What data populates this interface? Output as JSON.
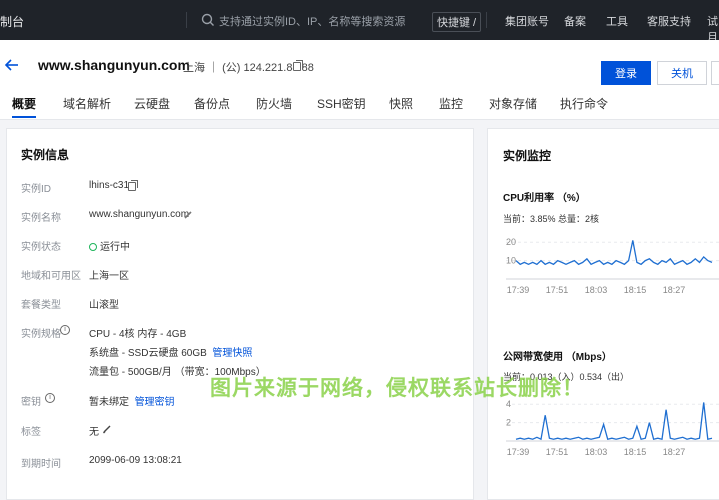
{
  "topbar": {
    "brand": "制台",
    "search_placeholder": "支持通过实例ID、IP、名称等搜索资源",
    "shortcut": "快捷键 /",
    "nav": [
      "集团账号",
      "备案",
      "工具",
      "客服支持",
      "试月"
    ]
  },
  "header": {
    "title": "www.shangunyun.com",
    "region": "上海 ｜ (公) 124.221.88.88",
    "login_button": "登录",
    "shutdown_button": "关机"
  },
  "tabs": [
    "概要",
    "域名解析",
    "云硬盘",
    "备份点",
    "防火墙",
    "SSH密钥",
    "快照",
    "监控",
    "对象存储",
    "执行命令"
  ],
  "instance": {
    "panel_title": "实例信息",
    "rows": {
      "id": {
        "label": "实例ID",
        "value": "lhins-c31"
      },
      "name": {
        "label": "实例名称",
        "value": "www.shangunyun.com"
      },
      "status": {
        "label": "实例状态",
        "value": "运行中"
      },
      "zone": {
        "label": "地域和可用区",
        "value": "上海一区"
      },
      "package": {
        "label": "套餐类型",
        "value": "山滚型"
      },
      "spec": {
        "label": "实例规格",
        "cpu": "CPU - 4核 内存 - 4GB",
        "disk": "系统盘 - SSD云硬盘 60GB",
        "disk_link": "管理快照",
        "traffic": "流量包 - 500GB/月 （带宽：100Mbps）"
      },
      "key": {
        "label": "密钥",
        "value": "暂未绑定",
        "link": "管理密钥"
      },
      "tags": {
        "label": "标签",
        "value": "无"
      },
      "expire": {
        "label": "到期时间",
        "value": "2099-06-09 13:08:21"
      }
    }
  },
  "monitor": {
    "panel_title": "实例监控",
    "cpu": {
      "title": "CPU利用率 （%）",
      "summary": "当前：3.85% 总量：2核"
    },
    "net": {
      "title": "公网带宽使用 （Mbps）",
      "summary": "当前：0.013（入）0.534（出）"
    }
  },
  "watermark": "图片来源于网络，侵权联系站长删除！",
  "chart_data": [
    {
      "type": "line",
      "title": "CPU利用率 （%）",
      "x": [
        "17:39",
        "17:51",
        "18:03",
        "18:15",
        "18:27"
      ],
      "yticks": [
        10,
        20
      ],
      "ylim": [
        0,
        25
      ],
      "color": "#1f6fd1",
      "series": [
        {
          "values": [
            10,
            8,
            9,
            8,
            9,
            8,
            10,
            8,
            9,
            8,
            10,
            9,
            8,
            9,
            10,
            8,
            9,
            11,
            8,
            9,
            10,
            8,
            9,
            8,
            10,
            9,
            8,
            10,
            21,
            9,
            8,
            10,
            11,
            9,
            8,
            10,
            9,
            11,
            8,
            9,
            10,
            8,
            9,
            11,
            9,
            12,
            10,
            9
          ]
        }
      ]
    },
    {
      "type": "line",
      "title": "公网带宽使用 （Mbps）",
      "x": [
        "17:39",
        "17:51",
        "18:03",
        "18:15",
        "18:27"
      ],
      "yticks": [
        2,
        4
      ],
      "ylim": [
        0,
        5
      ],
      "color": "#1f6fd1",
      "series": [
        {
          "values": [
            0.2,
            0.3,
            0.2,
            0.3,
            0.2,
            0.4,
            0.2,
            2.8,
            0.3,
            0.2,
            0.3,
            0.2,
            0.3,
            0.2,
            0.3,
            0.4,
            0.2,
            0.3,
            0.2,
            0.3,
            0.4,
            1.8,
            0.2,
            0.3,
            0.2,
            0.3,
            0.4,
            0.2,
            0.3,
            1.6,
            0.2,
            0.3,
            2.0,
            0.2,
            0.3,
            0.2,
            3.4,
            0.3,
            0.2,
            0.3,
            0.4,
            0.2,
            0.3,
            0.2,
            0.3,
            4.2,
            0.2,
            0.3
          ]
        }
      ]
    }
  ]
}
